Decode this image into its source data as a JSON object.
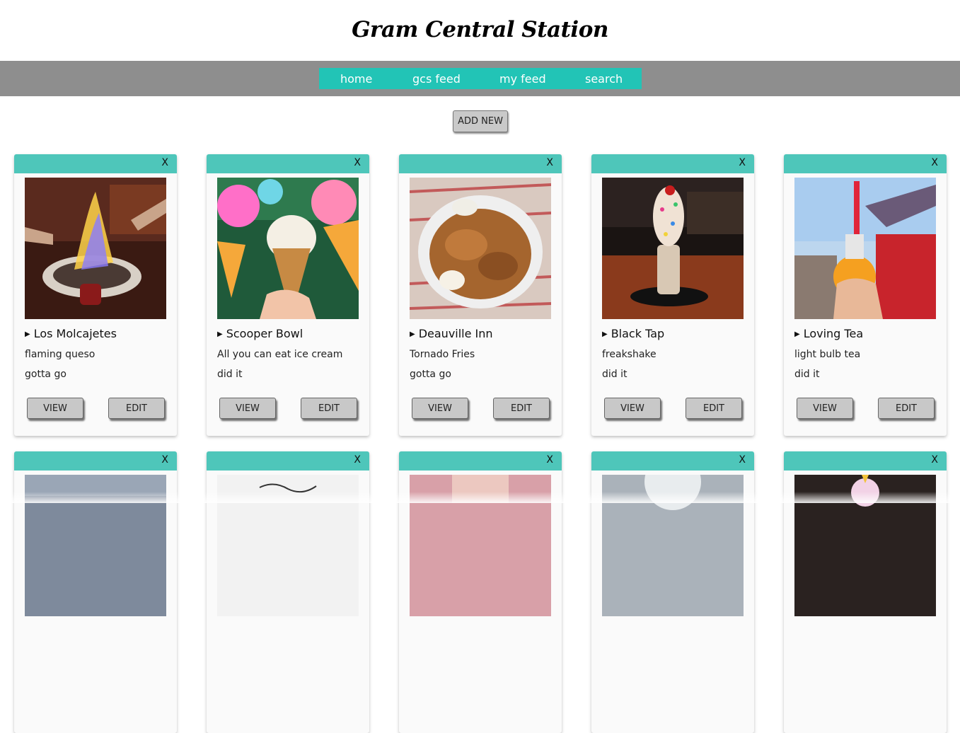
{
  "site_title": "Gram Central Station",
  "nav": [
    "home",
    "gcs feed",
    "my feed",
    "search"
  ],
  "add_new_label": "ADD NEW",
  "close_label": "X",
  "view_label": "VIEW",
  "edit_label": "EDIT",
  "cards": [
    {
      "name": "Los Molcajetes",
      "description": "flaming queso",
      "status": "gotta go"
    },
    {
      "name": "Scooper Bowl",
      "description": "All you can eat ice cream",
      "status": "did it"
    },
    {
      "name": "Deauville Inn",
      "description": "Tornado Fries",
      "status": "gotta go"
    },
    {
      "name": "Black Tap",
      "description": "freakshake",
      "status": "did it"
    },
    {
      "name": "Loving Tea",
      "description": "light bulb tea",
      "status": "did it"
    }
  ],
  "colors": {
    "navbar": "#8e8e8e",
    "nav_links_bg": "#22c4b6",
    "card_bar": "#4ec6ba"
  }
}
